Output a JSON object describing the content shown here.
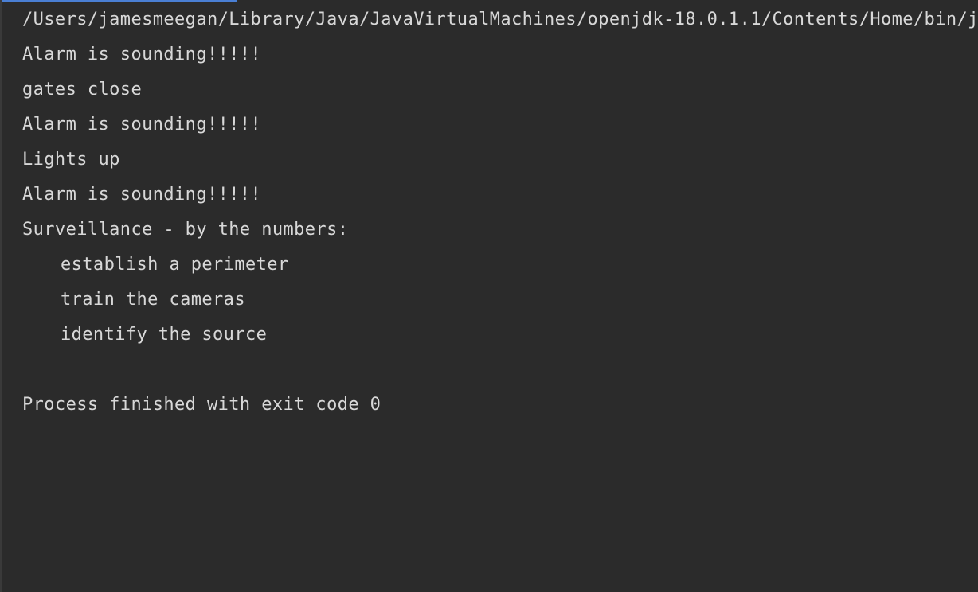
{
  "console": {
    "lines": [
      "/Users/jamesmeegan/Library/Java/JavaVirtualMachines/openjdk-18.0.1.1/Contents/Home/bin/java",
      "Alarm is sounding!!!!!",
      "gates close",
      "Alarm is sounding!!!!!",
      "Lights up",
      "Alarm is sounding!!!!!",
      "Surveillance - by the numbers:",
      "establish a perimeter",
      "train the cameras",
      "identify the source",
      "",
      "Process finished with exit code 0"
    ]
  },
  "colors": {
    "background": "#2b2b2b",
    "text": "#d8d8d8",
    "accent": "#4a7fd4"
  }
}
